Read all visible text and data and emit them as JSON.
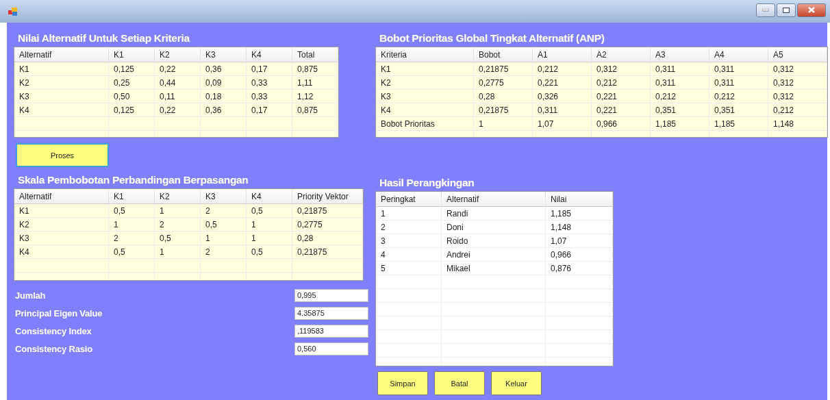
{
  "criteria_values": {
    "title": "Nilai Alternatif Untuk Setiap Kriteria",
    "columns": [
      "Alternatif",
      "K1",
      "K2",
      "K3",
      "K4",
      "Total"
    ],
    "rows": [
      [
        "K1",
        "0,125",
        "0,22",
        "0,36",
        "0,17",
        "0,875"
      ],
      [
        "K2",
        "0,25",
        "0,44",
        "0,09",
        "0,33",
        "1,11"
      ],
      [
        "K3",
        "0,50",
        "0,11",
        "0,18",
        "0,33",
        "1,12"
      ],
      [
        "K4",
        "0,125",
        "0,22",
        "0,36",
        "0,17",
        "0,875"
      ]
    ]
  },
  "process_button": "Proses",
  "global_priority": {
    "title": "Bobot Prioritas Global Tingkat Alternatif (ANP)",
    "columns": [
      "Kriteria",
      "Bobot",
      "A1",
      "A2",
      "A3",
      "A4",
      "A5"
    ],
    "rows": [
      [
        "K1",
        "0,21875",
        "0,212",
        "0,312",
        "0,311",
        "0,311",
        "0,312"
      ],
      [
        "K2",
        "0,2775",
        "0,221",
        "0,212",
        "0,311",
        "0,311",
        "0,312"
      ],
      [
        "K3",
        "0,28",
        "0,326",
        "0,221",
        "0,212",
        "0,212",
        "0,312"
      ],
      [
        "K4",
        "0,21875",
        "0,311",
        "0,221",
        "0,351",
        "0,351",
        "0,212"
      ],
      [
        "Bobot Prioritas",
        "1",
        "1,07",
        "0,966",
        "1,185",
        "1,185",
        "1,148"
      ]
    ]
  },
  "pairwise": {
    "title": "Skala Pembobotan Perbandingan Berpasangan",
    "columns": [
      "Alternatif",
      "K1",
      "K2",
      "K3",
      "K4",
      "Priority Vektor"
    ],
    "rows": [
      [
        "K1",
        "0,5",
        "1",
        "2",
        "0,5",
        "0,21875"
      ],
      [
        "K2",
        "1",
        "2",
        "0,5",
        "1",
        "0,2775"
      ],
      [
        "K3",
        "2",
        "0,5",
        "1",
        "1",
        "0,28"
      ],
      [
        "K4",
        "0,5",
        "1",
        "2",
        "0,5",
        "0,21875"
      ]
    ]
  },
  "summary": [
    {
      "label": "Jumlah",
      "value": "0,995"
    },
    {
      "label": "Principal Eigen Value",
      "value": "4.35875"
    },
    {
      "label": "Consistency Index",
      "value": ",119583"
    },
    {
      "label": "Consistency Rasio",
      "value": "0,560"
    }
  ],
  "ranking": {
    "title": "Hasil Perangkingan",
    "columns": [
      "Peringkat",
      "Alternatif",
      "Nilai"
    ],
    "rows": [
      [
        "1",
        "Randi",
        "1,185"
      ],
      [
        "2",
        "Doni",
        "1,148"
      ],
      [
        "3",
        "Roido",
        "1,07"
      ],
      [
        "4",
        "Andrei",
        "0,966"
      ],
      [
        "5",
        "Mikael",
        "0,876"
      ]
    ]
  },
  "action_buttons": [
    "Simpan",
    "Batal",
    "Keluar"
  ]
}
